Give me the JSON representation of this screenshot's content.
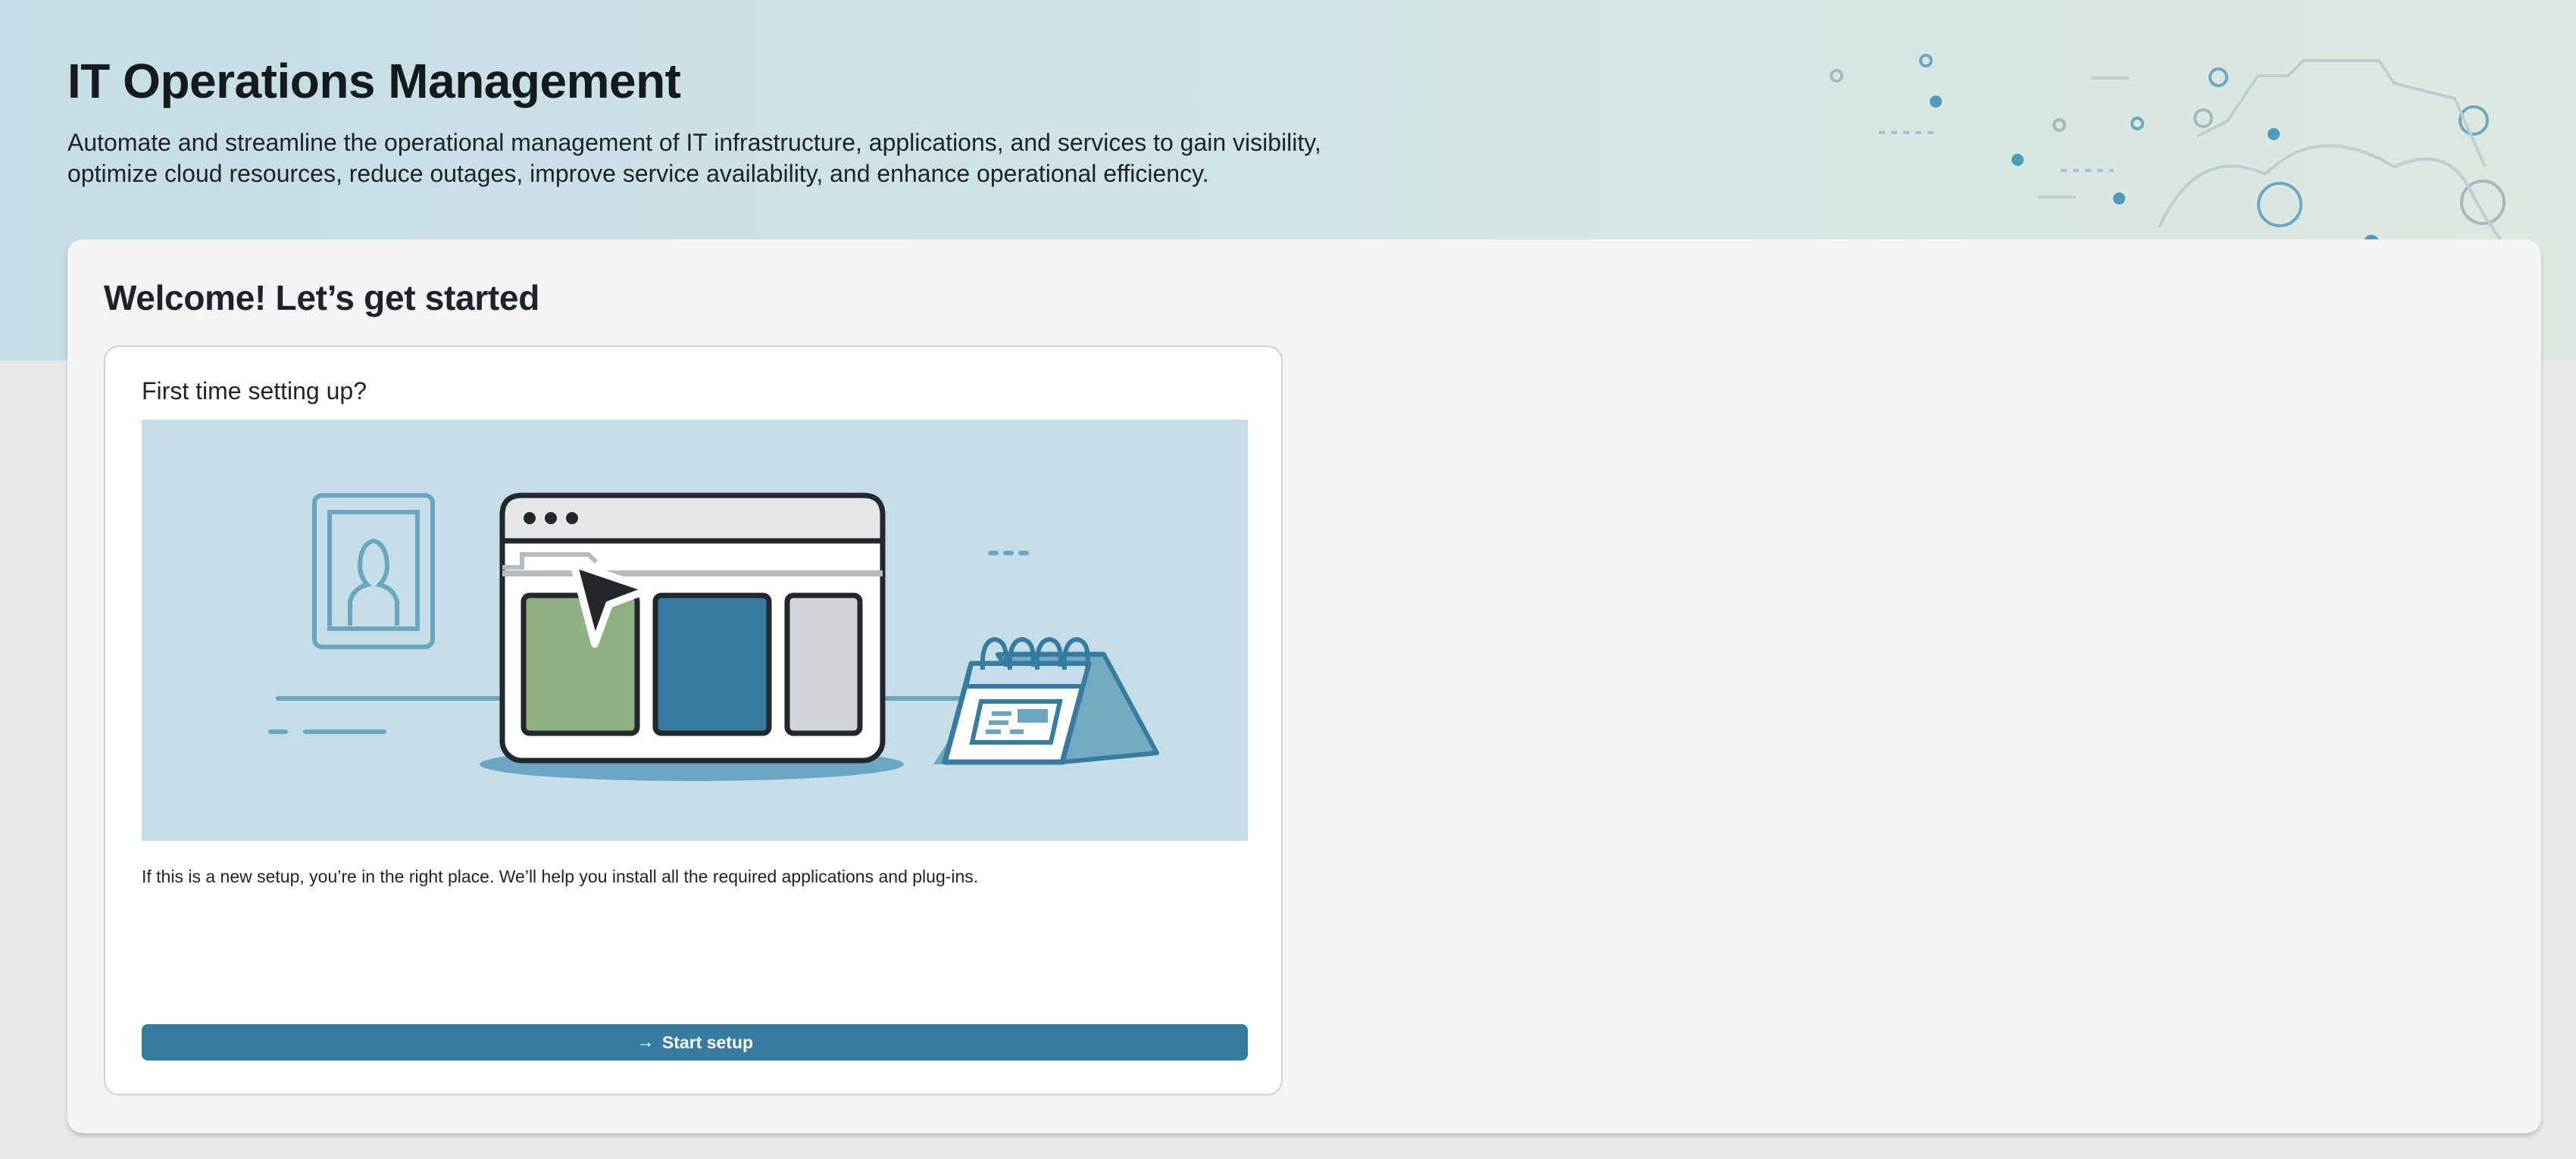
{
  "header": {
    "title": "IT Operations Management",
    "description": "Automate and streamline the operational management of IT infrastructure, applications, and services to gain visibility, optimize cloud resources, reduce outages, improve service availability, and enhance operational efficiency."
  },
  "panel": {
    "title": "Welcome! Let’s get started"
  },
  "setup_card": {
    "heading": "First time setting up?",
    "body": "If this is a new setup, you’re in the right place. We’ll help you install all the required applications and plug-ins.",
    "button": {
      "label": "Start setup",
      "icon": "arrow-right-icon"
    }
  },
  "colors": {
    "accent": "#357ca0",
    "panel_background": "#f3f4f6",
    "illustration_background": "#c4dde6"
  }
}
